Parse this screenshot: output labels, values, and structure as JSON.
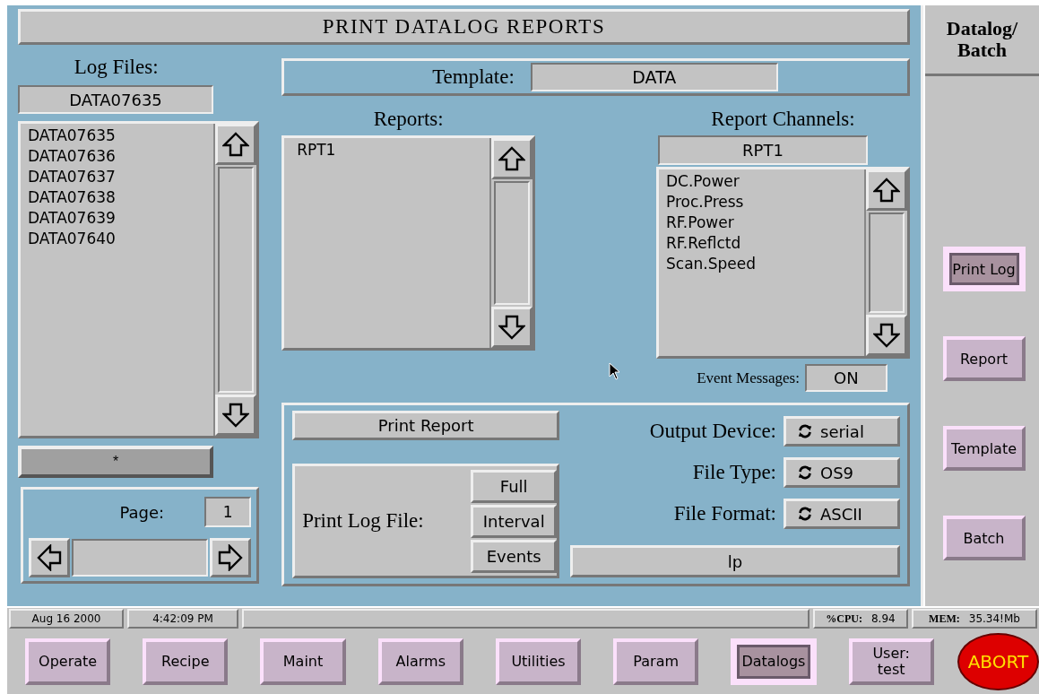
{
  "title": "PRINT DATALOG REPORTS",
  "log_files": {
    "label": "Log Files:",
    "current": "DATA07635",
    "items": [
      "DATA07635",
      "DATA07636",
      "DATA07637",
      "DATA07638",
      "DATA07639",
      "DATA07640"
    ],
    "filter_button": "*",
    "page": {
      "label": "Page:",
      "value": "1"
    }
  },
  "template": {
    "label": "Template:",
    "value": "DATA"
  },
  "reports": {
    "label": "Reports:",
    "items": [
      "RPT1"
    ]
  },
  "report_channels": {
    "label": "Report Channels:",
    "current": "RPT1",
    "items": [
      "DC.Power",
      "Proc.Press",
      "RF.Power",
      "RF.Reflctd",
      "Scan.Speed"
    ]
  },
  "event_messages": {
    "label": "Event Messages:",
    "value": "ON"
  },
  "print_report_button": "Print Report",
  "print_log_file": {
    "label": "Print Log File:",
    "buttons": [
      "Full",
      "Interval",
      "Events"
    ]
  },
  "output_settings": [
    {
      "label": "Output Device:",
      "value": "serial"
    },
    {
      "label": "File Type:",
      "value": "OS9"
    },
    {
      "label": "File Format:",
      "value": "ASCII"
    }
  ],
  "printer_field": "lp",
  "sidebar": {
    "title_lines": [
      "Datalog/",
      "Batch"
    ],
    "buttons": [
      {
        "label": "Print Log",
        "selected": true
      },
      {
        "label": "Report",
        "selected": false
      },
      {
        "label": "Template",
        "selected": false
      },
      {
        "label": "Batch",
        "selected": false
      }
    ]
  },
  "status_bar": {
    "date": "Aug 16 2000",
    "time": "4:42:09 PM",
    "cpu_label": "%CPU:",
    "cpu": "8.94",
    "mem_label": "MEM:",
    "mem": "35.34!Mb"
  },
  "nav": [
    {
      "label": "Operate",
      "selected": false
    },
    {
      "label": "Recipe",
      "selected": false
    },
    {
      "label": "Maint",
      "selected": false
    },
    {
      "label": "Alarms",
      "selected": false
    },
    {
      "label": "Utilities",
      "selected": false
    },
    {
      "label": "Param",
      "selected": false
    },
    {
      "label": "Datalogs",
      "selected": true
    },
    {
      "label": "User:\ntest",
      "selected": false
    }
  ],
  "abort_button": "ABORT"
}
